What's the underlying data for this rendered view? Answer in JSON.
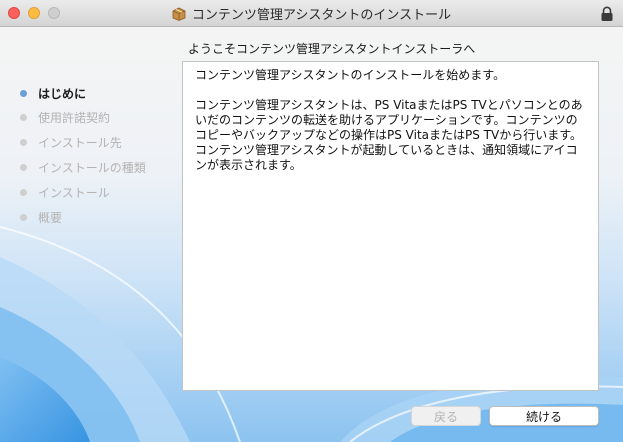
{
  "window": {
    "title": "コンテンツ管理アシスタントのインストール"
  },
  "sidebar": {
    "steps": [
      {
        "label": "はじめに",
        "active": true
      },
      {
        "label": "使用許諾契約",
        "active": false
      },
      {
        "label": "インストール先",
        "active": false
      },
      {
        "label": "インストールの種類",
        "active": false
      },
      {
        "label": "インストール",
        "active": false
      },
      {
        "label": "概要",
        "active": false
      }
    ]
  },
  "main": {
    "heading": "ようこそコンテンツ管理アシスタントインストーラへ",
    "paragraph1": "コンテンツ管理アシスタントのインストールを始めます。",
    "paragraph2": "コンテンツ管理アシスタントは、PS VitaまたはPS TVとパソコンとのあ\nいだのコンテンツの転送を助けるアプリケーションです。コンテンツの\nコピーやバックアップなどの操作はPS VitaまたはPS TVから行います。\nコンテンツ管理アシスタントが起動しているときは、通知領域にアイコ\nンが表示されます。"
  },
  "buttons": {
    "back": "戻る",
    "continue": "続ける"
  },
  "icons": {
    "title_icon": "package-icon",
    "lock": "lock-icon"
  },
  "colors": {
    "active_step_dot": "#6a9ed8",
    "background_swirl": "#5aa9e8"
  }
}
